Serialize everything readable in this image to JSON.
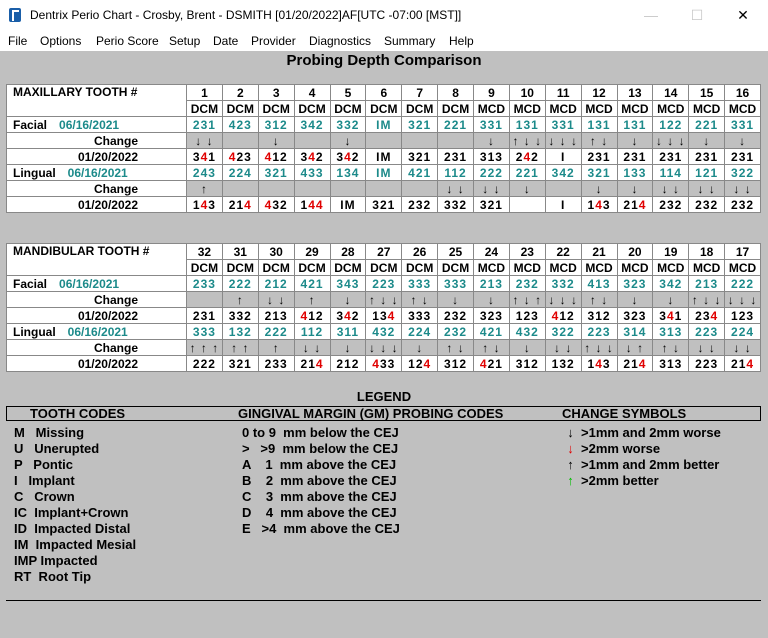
{
  "window": {
    "title": "Dentrix Perio Chart - Crosby, Brent - DSMITH [01/20/2022]AF[UTC -07:00 [MST]]",
    "minimize": "—",
    "maximize": "☐",
    "close": "✕"
  },
  "menu": [
    "File",
    "Options",
    "Perio Score",
    "Setup",
    "Date",
    "Provider",
    "Diagnostics",
    "Summary",
    "Help"
  ],
  "heading": "Probing Depth Comparison",
  "maxillary": {
    "label": "MAXILLARY TOOTH #",
    "teeth": [
      "1",
      "2",
      "3",
      "4",
      "5",
      "6",
      "7",
      "8",
      "9",
      "10",
      "11",
      "12",
      "13",
      "14",
      "15",
      "16"
    ],
    "sites": [
      "DCM",
      "DCM",
      "DCM",
      "DCM",
      "DCM",
      "DCM",
      "DCM",
      "DCM",
      "MCD",
      "MCD",
      "MCD",
      "MCD",
      "MCD",
      "MCD",
      "MCD",
      "MCD"
    ],
    "rows": [
      {
        "type": "base",
        "label": "Facial",
        "date": "06/16/2021",
        "cells": [
          "231",
          "423",
          "312",
          "342",
          "332",
          "IM",
          "321",
          "221",
          "331",
          "131",
          "331",
          "131",
          "131",
          "122",
          "221",
          "331"
        ]
      },
      {
        "type": "change",
        "label": "Change",
        "cells": [
          "↓↓",
          "",
          "↓",
          "",
          "↓",
          "",
          "",
          "",
          "↓",
          "↑↓↓",
          "↓↓↓",
          "↑↓",
          "↓",
          "↓↓↓",
          "↓",
          "↓"
        ]
      },
      {
        "type": "current",
        "label": "",
        "date": "01/20/2022",
        "cells": [
          "341",
          "423",
          "412",
          "342",
          "342",
          "IM",
          "321",
          "231",
          "313",
          "242",
          "I",
          "231",
          "231",
          "231",
          "231",
          "231"
        ]
      },
      {
        "type": "base",
        "label": "Lingual",
        "date": "06/16/2021",
        "cells": [
          "243",
          "224",
          "321",
          "433",
          "134",
          "IM",
          "421",
          "112",
          "222",
          "221",
          "342",
          "321",
          "133",
          "114",
          "121",
          "322"
        ]
      },
      {
        "type": "change",
        "label": "Change",
        "cells": [
          "↑",
          "",
          "",
          "",
          "",
          "",
          "",
          "↓↓",
          "↓↓",
          "↓",
          "",
          "↓",
          "↓",
          "↓↓",
          "↓↓",
          "↓↓"
        ]
      },
      {
        "type": "current",
        "label": "",
        "date": "01/20/2022",
        "cells": [
          "143",
          "214",
          "432",
          "144",
          "IM",
          "321",
          "232",
          "332",
          "321",
          "",
          "I",
          "143",
          "214",
          "232",
          "232",
          "232"
        ]
      }
    ]
  },
  "mandibular": {
    "label": "MANDIBULAR TOOTH #",
    "teeth": [
      "32",
      "31",
      "30",
      "29",
      "28",
      "27",
      "26",
      "25",
      "24",
      "23",
      "22",
      "21",
      "20",
      "19",
      "18",
      "17"
    ],
    "sites": [
      "DCM",
      "DCM",
      "DCM",
      "DCM",
      "DCM",
      "DCM",
      "DCM",
      "DCM",
      "MCD",
      "MCD",
      "MCD",
      "MCD",
      "MCD",
      "MCD",
      "MCD",
      "MCD"
    ],
    "rows": [
      {
        "type": "base",
        "label": "Facial",
        "date": "06/16/2021",
        "cells": [
          "233",
          "222",
          "212",
          "421",
          "343",
          "223",
          "333",
          "333",
          "213",
          "232",
          "332",
          "413",
          "323",
          "342",
          "213",
          "222"
        ]
      },
      {
        "type": "change",
        "label": "Change",
        "cells": [
          "",
          "↑",
          "↓↓",
          "↑",
          "↓",
          "↑↓↓",
          "↑↓",
          "↓",
          "↓",
          "↑↓↑",
          "↓↓↓",
          "↑↓",
          "↓",
          "↓",
          "↑↓↓",
          "↓↓↓"
        ]
      },
      {
        "type": "current",
        "label": "",
        "date": "01/20/2022",
        "cells": [
          "231",
          "332",
          "213",
          "412",
          "342",
          "134",
          "333",
          "232",
          "323",
          "123",
          "412",
          "312",
          "323",
          "341",
          "234",
          "123"
        ]
      },
      {
        "type": "base",
        "label": "Lingual",
        "date": "06/16/2021",
        "cells": [
          "333",
          "132",
          "222",
          "112",
          "311",
          "432",
          "224",
          "232",
          "421",
          "432",
          "322",
          "223",
          "314",
          "313",
          "223",
          "224"
        ]
      },
      {
        "type": "change",
        "label": "Change",
        "cells": [
          "↑↑↑",
          "↑↑",
          "↑",
          "↓↓",
          "↓",
          "↓↓↓",
          "↓",
          "↑↓",
          "↑↓",
          "↓",
          "↓↓",
          "↑↓↓",
          "↓↑",
          "↑↓",
          "↓↓",
          "↓↓"
        ]
      },
      {
        "type": "current",
        "label": "",
        "date": "01/20/2022",
        "cells": [
          "222",
          "321",
          "233",
          "214",
          "212",
          "433",
          "124",
          "312",
          "421",
          "312",
          "132",
          "143",
          "214",
          "313",
          "223",
          "214"
        ]
      }
    ]
  },
  "legend": {
    "title": "LEGEND",
    "tooth_codes_title": "TOOTH CODES",
    "gm_title": "GINGIVAL MARGIN (GM) PROBING CODES",
    "change_title": "CHANGE SYMBOLS",
    "tooth_codes": [
      "M   Missing",
      "U   Unerupted",
      "P   Pontic",
      "I   Implant",
      "C   Crown",
      "IC  Implant+Crown",
      "ID  Impacted Distal",
      "IM  Impacted Mesial",
      "IMP Impacted",
      "RT  Root Tip"
    ],
    "gm_codes": [
      "0 to 9  mm below the CEJ",
      ">   >9  mm below the CEJ",
      "A    1  mm above the CEJ",
      "B    2  mm above the CEJ",
      "C    3  mm above the CEJ",
      "D    4  mm above the CEJ",
      "E   >4  mm above the CEJ"
    ],
    "change_symbols": [
      {
        "symbol": "↓",
        "text": ">1mm and 2mm worse",
        "color": "#000000"
      },
      {
        "symbol": "↓",
        "text": ">2mm worse",
        "color": "#e00000"
      },
      {
        "symbol": "↑",
        "text": ">1mm and 2mm better",
        "color": "#000000"
      },
      {
        "symbol": "↑",
        "text": ">2mm better",
        "color": "#00c000"
      }
    ]
  },
  "colors": {
    "teal": "#1c8a8a",
    "red": "#e00000",
    "green": "#00c000",
    "background": "#c0c0c0"
  }
}
